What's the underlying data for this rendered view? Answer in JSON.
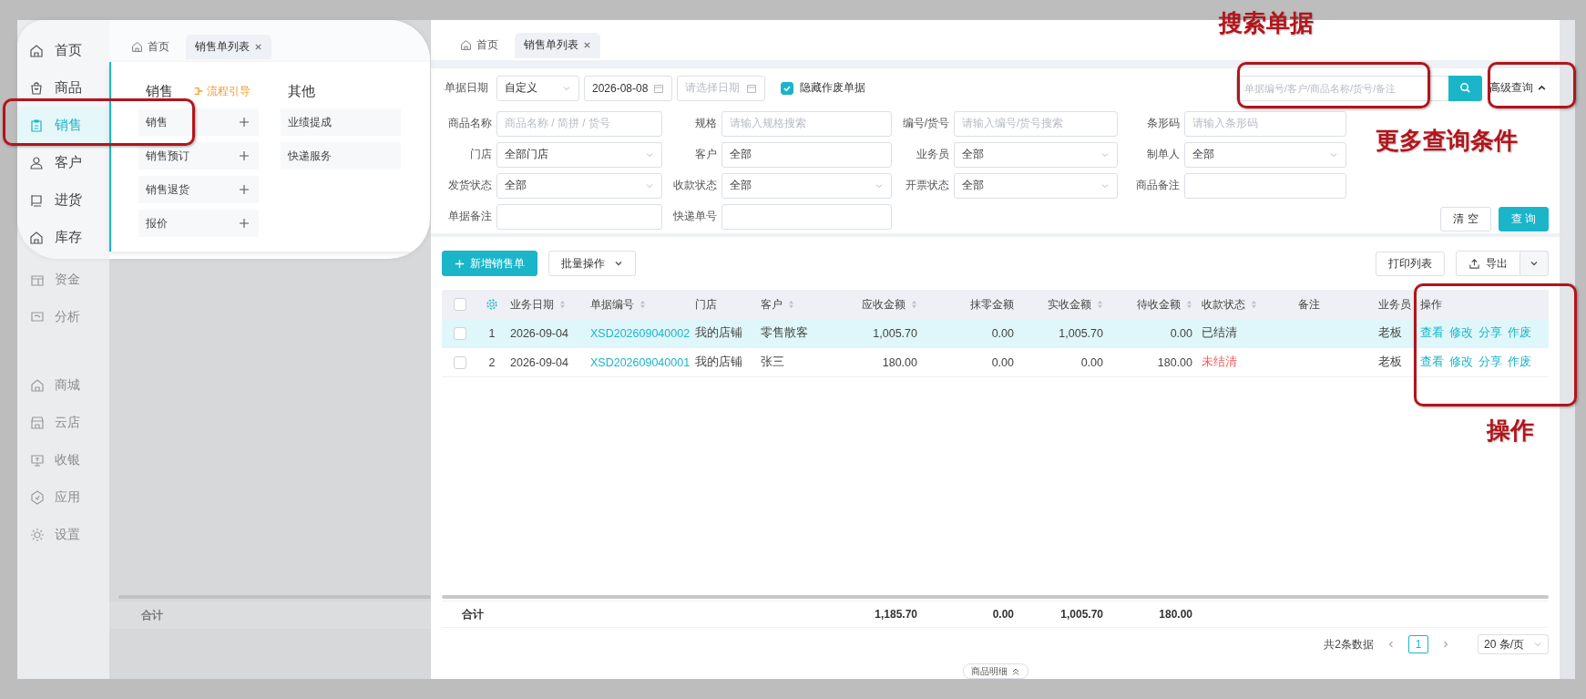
{
  "sidebar": {
    "main_items": [
      {
        "label": "资金"
      },
      {
        "label": "分析"
      }
    ],
    "app_items": [
      {
        "label": "商城"
      },
      {
        "label": "云店"
      },
      {
        "label": "收银"
      },
      {
        "label": "应用"
      },
      {
        "label": "设置"
      }
    ]
  },
  "background_page": {
    "total_label": "合计"
  },
  "magnifier": {
    "sidebar_items": [
      {
        "label": "首页",
        "selected": false
      },
      {
        "label": "商品",
        "selected": false
      },
      {
        "label": "销售",
        "selected": true
      },
      {
        "label": "客户",
        "selected": false
      },
      {
        "label": "进货",
        "selected": false
      },
      {
        "label": "库存",
        "selected": false
      }
    ],
    "tabs": [
      {
        "label": "首页",
        "selected": false
      },
      {
        "label": "销售单列表",
        "selected": true
      }
    ],
    "menu_columns": [
      {
        "title": "销售",
        "guide_link": "流程引导",
        "items": [
          {
            "label": "销售",
            "addable": true
          },
          {
            "label": "销售预订",
            "addable": true
          },
          {
            "label": "销售退货",
            "addable": true
          },
          {
            "label": "报价",
            "addable": true
          }
        ]
      },
      {
        "title": "其他",
        "items": [
          {
            "label": "业绩提成",
            "addable": false
          },
          {
            "label": "快递服务",
            "addable": false
          }
        ]
      }
    ]
  },
  "tabs": [
    {
      "label": "首页",
      "selected": false
    },
    {
      "label": "销售单列表",
      "selected": true
    }
  ],
  "date_filter": {
    "label": "单据日期",
    "range_type": "自定义",
    "start": "2026-08-08",
    "end_placeholder": "请选择日期"
  },
  "hide_void": {
    "label": "隐藏作废单据",
    "checked": true
  },
  "search": {
    "placeholder": "单据编号/客户/商品名称/货号/备注",
    "advanced_label": "高级查询",
    "expanded": true
  },
  "filters": [
    {
      "label": "商品名称",
      "kind": "input",
      "placeholder": "商品名称 / 简拼 / 货号"
    },
    {
      "label": "规格",
      "kind": "input",
      "placeholder": "请输入规格搜索"
    },
    {
      "label": "编号/货号",
      "kind": "input",
      "placeholder": "请输入编号/货号搜索"
    },
    {
      "label": "条形码",
      "kind": "input",
      "placeholder": "请输入条形码"
    },
    {
      "label": "门店",
      "kind": "select",
      "value": "全部门店"
    },
    {
      "label": "客户",
      "kind": "input",
      "value": "全部"
    },
    {
      "label": "业务员",
      "kind": "select",
      "value": "全部"
    },
    {
      "label": "制单人",
      "kind": "select",
      "value": "全部"
    },
    {
      "label": "发货状态",
      "kind": "select",
      "value": "全部"
    },
    {
      "label": "收款状态",
      "kind": "select",
      "value": "全部"
    },
    {
      "label": "开票状态",
      "kind": "select",
      "value": "全部"
    },
    {
      "label": "商品备注",
      "kind": "input"
    },
    {
      "label": "单据备注",
      "kind": "input"
    },
    {
      "label": "快递单号",
      "kind": "input"
    }
  ],
  "filter_buttons": {
    "clear": "清 空",
    "query": "查 询"
  },
  "toolbar": {
    "new_button": "新增销售单",
    "batch_button": "批量操作",
    "print_button": "打印列表",
    "export_button": "导出"
  },
  "table": {
    "columns": [
      {
        "kind": "checkbox",
        "checked": false
      },
      {
        "kind": "settings"
      },
      {
        "kind": "text",
        "label": "业务日期",
        "sortable": true
      },
      {
        "kind": "text",
        "label": "单据编号",
        "sortable": true
      },
      {
        "kind": "text",
        "label": "门店",
        "sortable": false
      },
      {
        "kind": "text",
        "label": "客户",
        "sortable": true
      },
      {
        "kind": "text",
        "label": "应收金额",
        "sortable": true
      },
      {
        "kind": "text",
        "label": "抹零金额",
        "sortable": false
      },
      {
        "kind": "text",
        "label": "实收金额",
        "sortable": true
      },
      {
        "kind": "text",
        "label": "待收金额",
        "sortable": true
      },
      {
        "kind": "text",
        "label": "收款状态",
        "sortable": true
      },
      {
        "kind": "text",
        "label": "备注",
        "sortable": false
      },
      {
        "kind": "text",
        "label": "业务员",
        "sortable": false
      },
      {
        "kind": "text",
        "label": "操作",
        "sortable": false
      }
    ],
    "rows": [
      {
        "selected": true,
        "checked": false,
        "index": "1",
        "date": "2026-09-04",
        "number": "XSD202609040002",
        "store": "我的店铺",
        "customer": "零售散客",
        "receivable": "1,005.70",
        "rounding": "0.00",
        "received": "1,005.70",
        "pending": "0.00",
        "status": "已结清",
        "settled": true,
        "salesperson": "老板",
        "actions": [
          "查看",
          "修改",
          "分享",
          "作废"
        ]
      },
      {
        "selected": false,
        "checked": false,
        "index": "2",
        "date": "2026-09-04",
        "number": "XSD202609040001",
        "store": "我的店铺",
        "customer": "张三",
        "receivable": "180.00",
        "rounding": "0.00",
        "received": "0.00",
        "pending": "180.00",
        "status": "未结清",
        "settled": false,
        "salesperson": "老板",
        "actions": [
          "查看",
          "修改",
          "分享",
          "作废"
        ]
      }
    ],
    "totals": {
      "label": "合计",
      "receivable": "1,185.70",
      "rounding": "0.00",
      "received": "1,005.70",
      "pending": "180.00"
    }
  },
  "pagination": {
    "summary": "共2条数据",
    "pages": [
      {
        "label": "1",
        "selected": true
      }
    ],
    "page_size": "20 条/页"
  },
  "detail_toggle": "商品明细",
  "annotations": [
    {
      "text": "搜索单据"
    },
    {
      "text": "更多查询条件"
    },
    {
      "text": "操作"
    }
  ]
}
